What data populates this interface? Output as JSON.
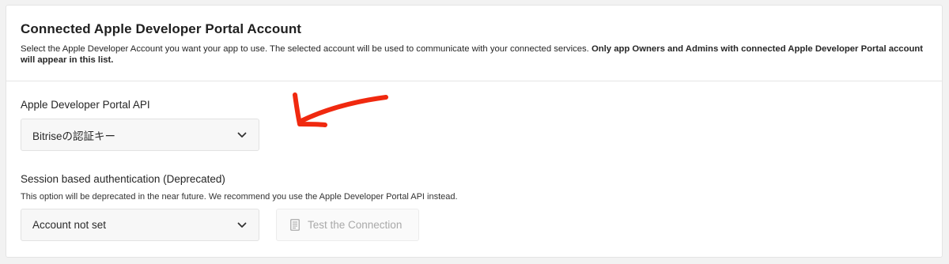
{
  "header": {
    "title": "Connected Apple Developer Portal Account",
    "description": "Select the Apple Developer Account you want your app to use. The selected account will be used to communicate with your connected services.",
    "description_bold": "Only app Owners and Admins with connected Apple Developer Portal account will appear in this list."
  },
  "api_section": {
    "label": "Apple Developer Portal API",
    "selected_value": "Bitriseの認証キー"
  },
  "session_section": {
    "label": "Session based authentication (Deprecated)",
    "note": "This option will be deprecated in the near future. We recommend you use the Apple Developer Portal API instead.",
    "selected_value": "Account not set",
    "test_button_label": "Test the Connection",
    "test_button_disabled": true
  },
  "annotation": {
    "arrow_color": "#f0290f",
    "points_to": "api_section"
  },
  "icons": {
    "dropdown": "chevron-down-icon",
    "test": "document-icon"
  },
  "colors": {
    "page_background": "#f2f2f2",
    "card_background": "#ffffff",
    "select_background": "#f7f7f7",
    "disabled_text": "#a9a9a9"
  }
}
